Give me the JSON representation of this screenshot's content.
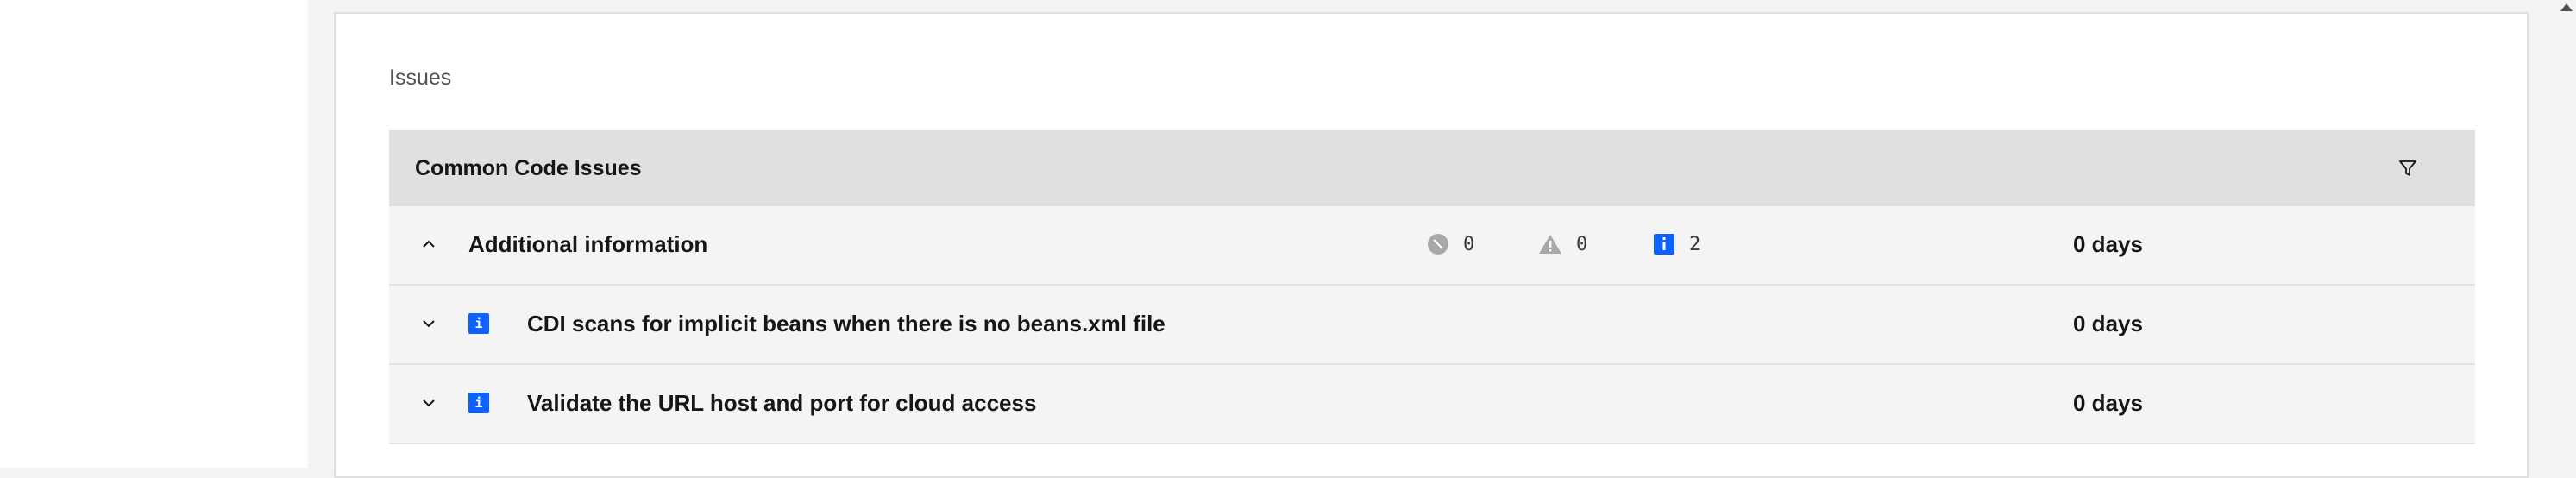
{
  "page": {
    "section_title": "Issues"
  },
  "table": {
    "title": "Common Code Issues",
    "rows": [
      {
        "title": "Additional information",
        "expanded": true,
        "counts": {
          "critical": "0",
          "warning": "0",
          "info": "2"
        },
        "days": "0 days"
      },
      {
        "title": "CDI scans for implicit beans when there is no beans.xml file",
        "expanded": false,
        "icon": "info-icon",
        "badge": "i",
        "days": "0 days"
      },
      {
        "title": "Validate the URL host and port for cloud access",
        "expanded": false,
        "icon": "info-icon",
        "badge": "i",
        "days": "0 days"
      }
    ]
  },
  "colors": {
    "info": "#0f62fe",
    "header_bg": "#e0e0e0",
    "row_bg": "#f4f4f4",
    "muted_icon": "#a8a8a8"
  }
}
